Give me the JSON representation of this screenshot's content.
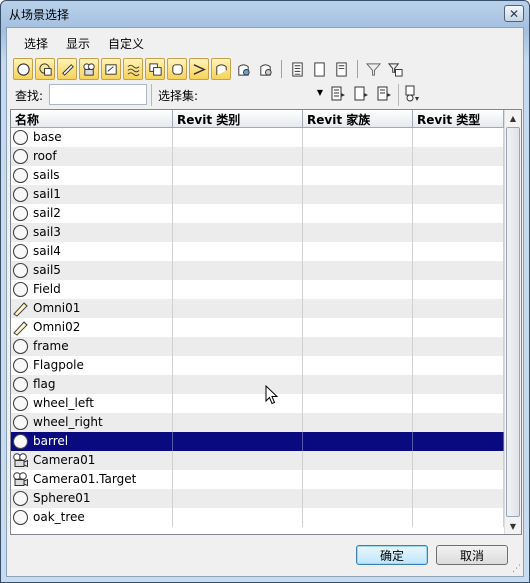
{
  "window": {
    "title": "从场景选择",
    "close_glyph": "✕"
  },
  "menu": [
    "选择",
    "显示",
    "自定义"
  ],
  "toolbar": {
    "icons": [
      "display-geometry-icon",
      "display-shapes-icon",
      "display-lights-icon",
      "display-cameras-icon",
      "display-helpers-icon",
      "display-spacewarps-icon",
      "display-groups-icon",
      "display-xrefs-icon",
      "display-bones-icon",
      "display-containers-icon",
      "display-frozen-icon",
      "display-hidden-icon",
      "select-all-icon",
      "select-none-icon",
      "select-invert-icon",
      "filter-icon",
      "filter-options-icon"
    ]
  },
  "search": {
    "find_label": "查找:",
    "find_value": "",
    "selection_set_label": "选择集:",
    "selection_set_value": ""
  },
  "columns": [
    "名称",
    "Revit 类别",
    "Revit 家族",
    "Revit 类型"
  ],
  "rows": [
    {
      "name": "base",
      "icon": "geometry"
    },
    {
      "name": "roof",
      "icon": "geometry"
    },
    {
      "name": "sails",
      "icon": "geometry"
    },
    {
      "name": "sail1",
      "icon": "geometry"
    },
    {
      "name": "sail2",
      "icon": "geometry"
    },
    {
      "name": "sail3",
      "icon": "geometry"
    },
    {
      "name": "sail4",
      "icon": "geometry"
    },
    {
      "name": "sail5",
      "icon": "geometry"
    },
    {
      "name": "Field",
      "icon": "geometry"
    },
    {
      "name": "Omni01",
      "icon": "light"
    },
    {
      "name": "Omni02",
      "icon": "light"
    },
    {
      "name": "frame",
      "icon": "geometry"
    },
    {
      "name": "Flagpole",
      "icon": "geometry"
    },
    {
      "name": "flag",
      "icon": "geometry"
    },
    {
      "name": "wheel_left",
      "icon": "geometry"
    },
    {
      "name": "wheel_right",
      "icon": "geometry"
    },
    {
      "name": "barrel",
      "icon": "geometry",
      "selected": true
    },
    {
      "name": "Camera01",
      "icon": "camera"
    },
    {
      "name": "Camera01.Target",
      "icon": "camera"
    },
    {
      "name": "Sphere01",
      "icon": "geometry"
    },
    {
      "name": "oak_tree",
      "icon": "geometry"
    }
  ],
  "buttons": {
    "ok": "确定",
    "cancel": "取消"
  },
  "colors": {
    "selection": "#0a0a80",
    "toolbar_active": "#f7d25a"
  }
}
